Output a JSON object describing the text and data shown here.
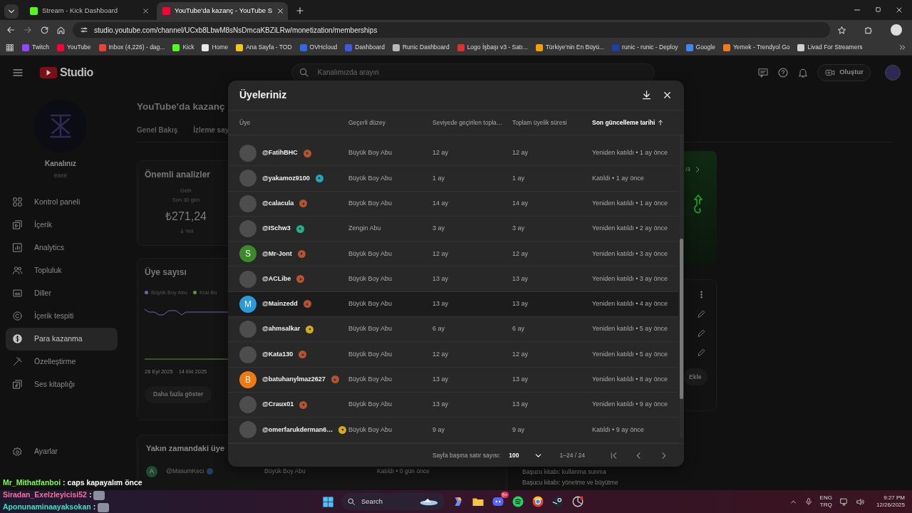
{
  "browser": {
    "tabs": [
      {
        "title": "Stream - Kick Dashboard",
        "selected": false
      },
      {
        "title": "YouTube'da kazanç - YouTube S",
        "selected": true
      }
    ],
    "url": "studio.youtube.com/channel/UCxb8LbwM8sNsDmcaKBZiLRw/monetization/memberships",
    "bookmarks": [
      {
        "label": "Twitch",
        "color": "#9146ff"
      },
      {
        "label": "YouTube",
        "color": "#ff0033"
      },
      {
        "label": "Inbox (4,226) - dag...",
        "color": "#ea4335"
      },
      {
        "label": "Kick",
        "color": "#53fc18"
      },
      {
        "label": "Home",
        "color": "#e8e8e8"
      },
      {
        "label": "Ana Sayfa - TOD",
        "color": "#f5c518"
      },
      {
        "label": "OVHcloud",
        "color": "#2b6be6"
      },
      {
        "label": "Dashboard",
        "color": "#3b5bdb"
      },
      {
        "label": "Runic Dashboard",
        "color": "#b8b8b8"
      },
      {
        "label": "Logo İşbaşı v3 - Satı...",
        "color": "#e03131"
      },
      {
        "label": "Türkiye'nin En Büyü...",
        "color": "#f59f00"
      },
      {
        "label": "runic - runic - Deploy",
        "color": "#1c3faa"
      },
      {
        "label": "Google",
        "color": "#4285f4"
      },
      {
        "label": "Yemek - Trendyol Go",
        "color": "#f27a1a"
      },
      {
        "label": "Livad For Streamers",
        "color": "#d0d0d0"
      }
    ]
  },
  "studio": {
    "logo_text": "Studio",
    "search": {
      "placeholder": "Kanalımızda arayın"
    },
    "create_button": "Oluştur",
    "sidebar": {
      "channel_label": "Kanalınız",
      "channel_name": "exee",
      "items": [
        {
          "label": "Kontrol paneli",
          "selected": false
        },
        {
          "label": "İçerik",
          "selected": false
        },
        {
          "label": "Analytics",
          "selected": false
        },
        {
          "label": "Topluluk",
          "selected": false
        },
        {
          "label": "Diller",
          "selected": false
        },
        {
          "label": "İçerik tespiti",
          "selected": false
        },
        {
          "label": "Para kazanma",
          "selected": true
        },
        {
          "label": "Özelleştirme",
          "selected": false
        },
        {
          "label": "Ses kitaplığı",
          "selected": false
        }
      ],
      "settings": "Ayarlar"
    },
    "page": {
      "title": "YouTube'da kazanç",
      "tabs": [
        "Genel Bakış",
        "İzleme say"
      ],
      "analytics": {
        "title": "Önemli analizler",
        "metric_label": "Gelir",
        "period": "Son 30 gün",
        "value": "₺271,24",
        "change": "%9"
      },
      "members_card": {
        "title": "Üye sayısı",
        "legend": [
          {
            "label": "Büyük Boy Abu",
            "color": "#6b63b5"
          },
          {
            "label": "Kral Bo",
            "color": "#5f9a2e"
          }
        ],
        "dates": [
          "26 Eyl 2025",
          "14 Eki 2025"
        ],
        "button": "Daha fazla göster"
      },
      "recent": {
        "title": "Yakın zamandaki üye",
        "rows": [
          {
            "letter": "A",
            "name": "@MasumKeci",
            "level": "Büyük Boy Abu",
            "joined": "Katıldı • 0 gün önce"
          }
        ]
      },
      "promo_pager": "/3",
      "add_button": "Ekle",
      "guides": [
        "Başucu kitabı: kullanma sunma",
        "Başucu kitabı: yönetme ve büyütme"
      ]
    }
  },
  "modal": {
    "title": "Üyeleriniz",
    "columns": [
      {
        "label": "Üye",
        "sorted": false
      },
      {
        "label": "Geçerli düzey",
        "sorted": false
      },
      {
        "label": "Seviyede geçirilen topla…",
        "sorted": false
      },
      {
        "label": "Toplam üyelik süresi",
        "sorted": false
      },
      {
        "label": "Son güncelleme tarihi",
        "sorted": true
      }
    ],
    "rows": [
      {
        "avatar": {
          "kind": "photo"
        },
        "name": "@FatihBHC",
        "badge": {
          "color": "#b5532f"
        },
        "level": "Büyük Boy Abu",
        "time_at_level": "12 ay",
        "total": "12 ay",
        "updated": "Yeniden katıldı • 1 ay önce",
        "highlighted": false
      },
      {
        "avatar": {
          "kind": "photo"
        },
        "name": "@yakamoz9100",
        "badge": {
          "color": "#29a3b3"
        },
        "level": "Büyük Boy Abu",
        "time_at_level": "1 ay",
        "total": "1 ay",
        "updated": "Katıldı • 1 ay önce",
        "highlighted": false
      },
      {
        "avatar": {
          "kind": "photo"
        },
        "name": "@calacula",
        "badge": {
          "color": "#b5532f"
        },
        "level": "Büyük Boy Abu",
        "time_at_level": "14 ay",
        "total": "14 ay",
        "updated": "Yeniden katıldı • 1 ay önce",
        "highlighted": false
      },
      {
        "avatar": {
          "kind": "photo"
        },
        "name": "@ISchw3",
        "badge": {
          "color": "#23b08a"
        },
        "level": "Zengin Abu",
        "time_at_level": "3 ay",
        "total": "3 ay",
        "updated": "Yeniden katıldı • 2 ay önce",
        "highlighted": false
      },
      {
        "avatar": {
          "kind": "letter",
          "letter": "S",
          "color": "#3a8a2a"
        },
        "name": "@Mr-Jont",
        "badge": {
          "color": "#b5532f"
        },
        "level": "Büyük Boy Abu",
        "time_at_level": "12 ay",
        "total": "12 ay",
        "updated": "Yeniden katıldı • 3 ay önce",
        "highlighted": false
      },
      {
        "avatar": {
          "kind": "photo"
        },
        "name": "@ACLibe",
        "badge": {
          "color": "#b5532f"
        },
        "level": "Büyük Boy Abu",
        "time_at_level": "13 ay",
        "total": "13 ay",
        "updated": "Yeniden katıldı • 3 ay önce",
        "highlighted": false
      },
      {
        "avatar": {
          "kind": "letter",
          "letter": "M",
          "color": "#2a9ad9"
        },
        "name": "@Mainzedd",
        "badge": {
          "color": "#b5532f"
        },
        "level": "Büyük Boy Abu",
        "time_at_level": "13 ay",
        "total": "13 ay",
        "updated": "Yeniden katıldı • 4 ay önce",
        "highlighted": true
      },
      {
        "avatar": {
          "kind": "photo"
        },
        "name": "@ahmsalkar",
        "badge": {
          "color": "#d4aa1f"
        },
        "level": "Büyük Boy Abu",
        "time_at_level": "6 ay",
        "total": "6 ay",
        "updated": "Yeniden katıldı • 5 ay önce",
        "highlighted": false
      },
      {
        "avatar": {
          "kind": "photo"
        },
        "name": "@Kata130",
        "badge": {
          "color": "#b5532f"
        },
        "level": "Büyük Boy Abu",
        "time_at_level": "12 ay",
        "total": "12 ay",
        "updated": "Yeniden katıldı • 5 ay önce",
        "highlighted": false
      },
      {
        "avatar": {
          "kind": "letter",
          "letter": "B",
          "color": "#ef7a12"
        },
        "name": "@batuhanylmaz2627",
        "badge": {
          "color": "#b5532f"
        },
        "level": "Büyük Boy Abu",
        "time_at_level": "13 ay",
        "total": "13 ay",
        "updated": "Yeniden katıldı • 8 ay önce",
        "highlighted": false
      },
      {
        "avatar": {
          "kind": "photo"
        },
        "name": "@Craux01",
        "badge": {
          "color": "#b5532f"
        },
        "level": "Büyük Boy Abu",
        "time_at_level": "13 ay",
        "total": "13 ay",
        "updated": "Yeniden katıldı • 9 ay önce",
        "highlighted": false
      },
      {
        "avatar": {
          "kind": "photo"
        },
        "name": "@omerfarukderman6…",
        "badge": {
          "color": "#d4aa1f"
        },
        "level": "Büyük Boy Abu",
        "time_at_level": "9 ay",
        "total": "9 ay",
        "updated": "Katıldı • 9 ay önce",
        "highlighted": false
      }
    ],
    "footer": {
      "rows_per_page_label": "Sayfa başına satır sayısı:",
      "rows_per_page": "100",
      "range": "1–24 / 24"
    }
  },
  "chat": [
    {
      "user": "Mr_Mithatfanboi",
      "color": "#7cfc4a",
      "sep": ":",
      "message": "caps kapayalım önce"
    },
    {
      "user": "Siradan_Exelzleyicisi52",
      "color": "#ff6f9e",
      "sep": ":"
    },
    {
      "user": "Aponunaminaayaksokan",
      "color": "#3fe0c0",
      "sep": ":"
    }
  ],
  "taskbar": {
    "search": "Search",
    "discord_badge": "9+",
    "lang_top": "ENG",
    "lang_bottom": "TRQ",
    "time": "9:27 PM",
    "date": "12/26/2025"
  }
}
